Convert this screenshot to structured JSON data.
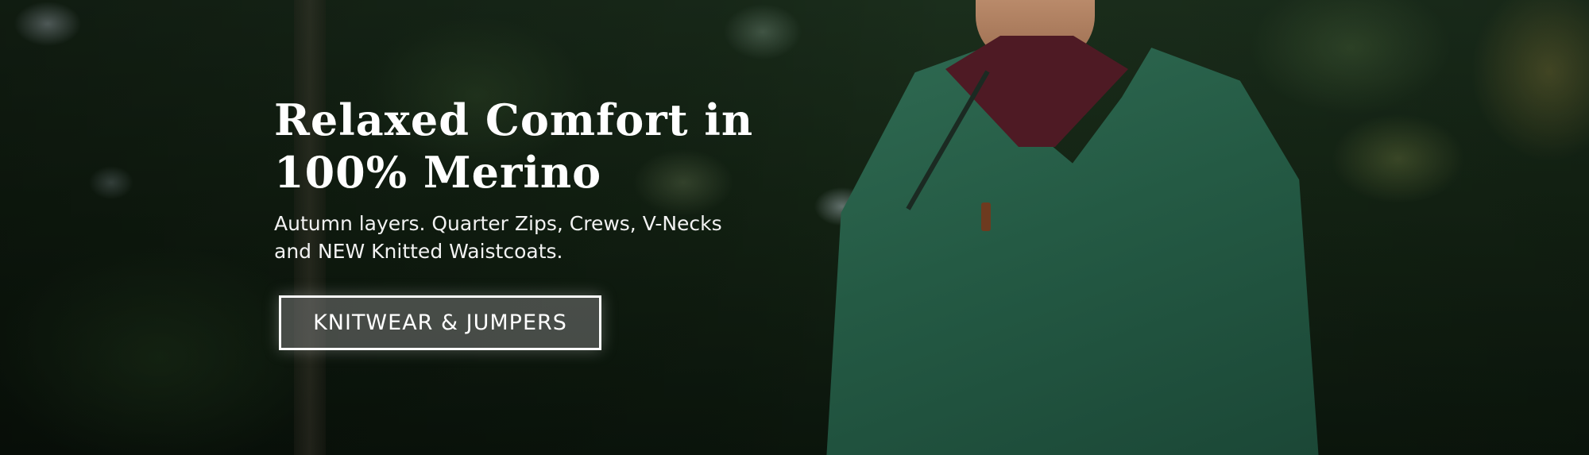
{
  "hero": {
    "headline": "Relaxed Comfort in\n100% Merino",
    "subheadline": "Autumn layers. Quarter Zips, Crews, V-Necks\nand NEW Knitted Waistcoats.",
    "cta_label": "KNITWEAR & JUMPERS"
  },
  "colors": {
    "text": "#ffffff",
    "sweater": "#2f6a52",
    "shirt": "#4e1a24",
    "cta_border": "#ffffff"
  }
}
